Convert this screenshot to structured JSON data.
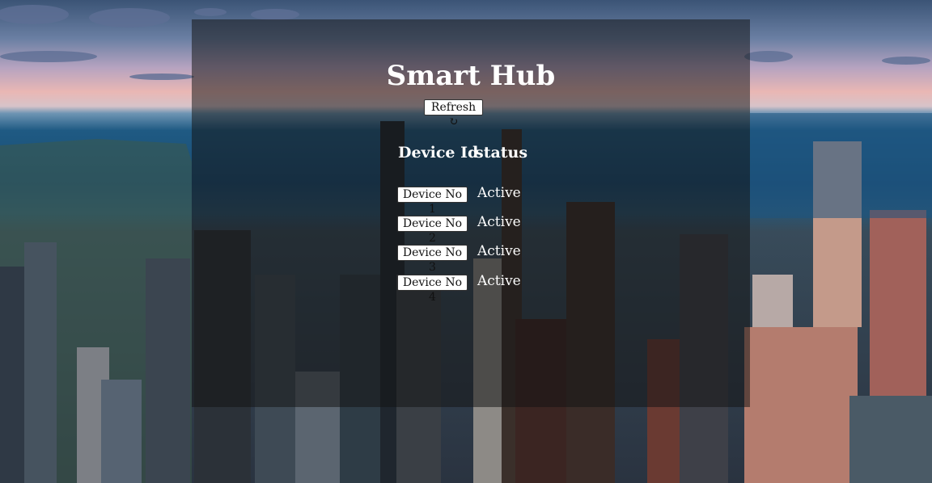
{
  "app": {
    "title": "Smart Hub",
    "refresh_label": "Refresh",
    "refresh_icon": "↻"
  },
  "table": {
    "headers": [
      "Device Id",
      "status"
    ],
    "rows": [
      {
        "device": "Device No 1",
        "status": "Active"
      },
      {
        "device": "Device No 2",
        "status": "Active"
      },
      {
        "device": "Device No 3",
        "status": "Active"
      },
      {
        "device": "Device No 4",
        "status": "Active"
      }
    ]
  },
  "colors": {
    "panel_overlay": "#141414",
    "text": "#ffffff",
    "button_bg": "#ffffff"
  }
}
